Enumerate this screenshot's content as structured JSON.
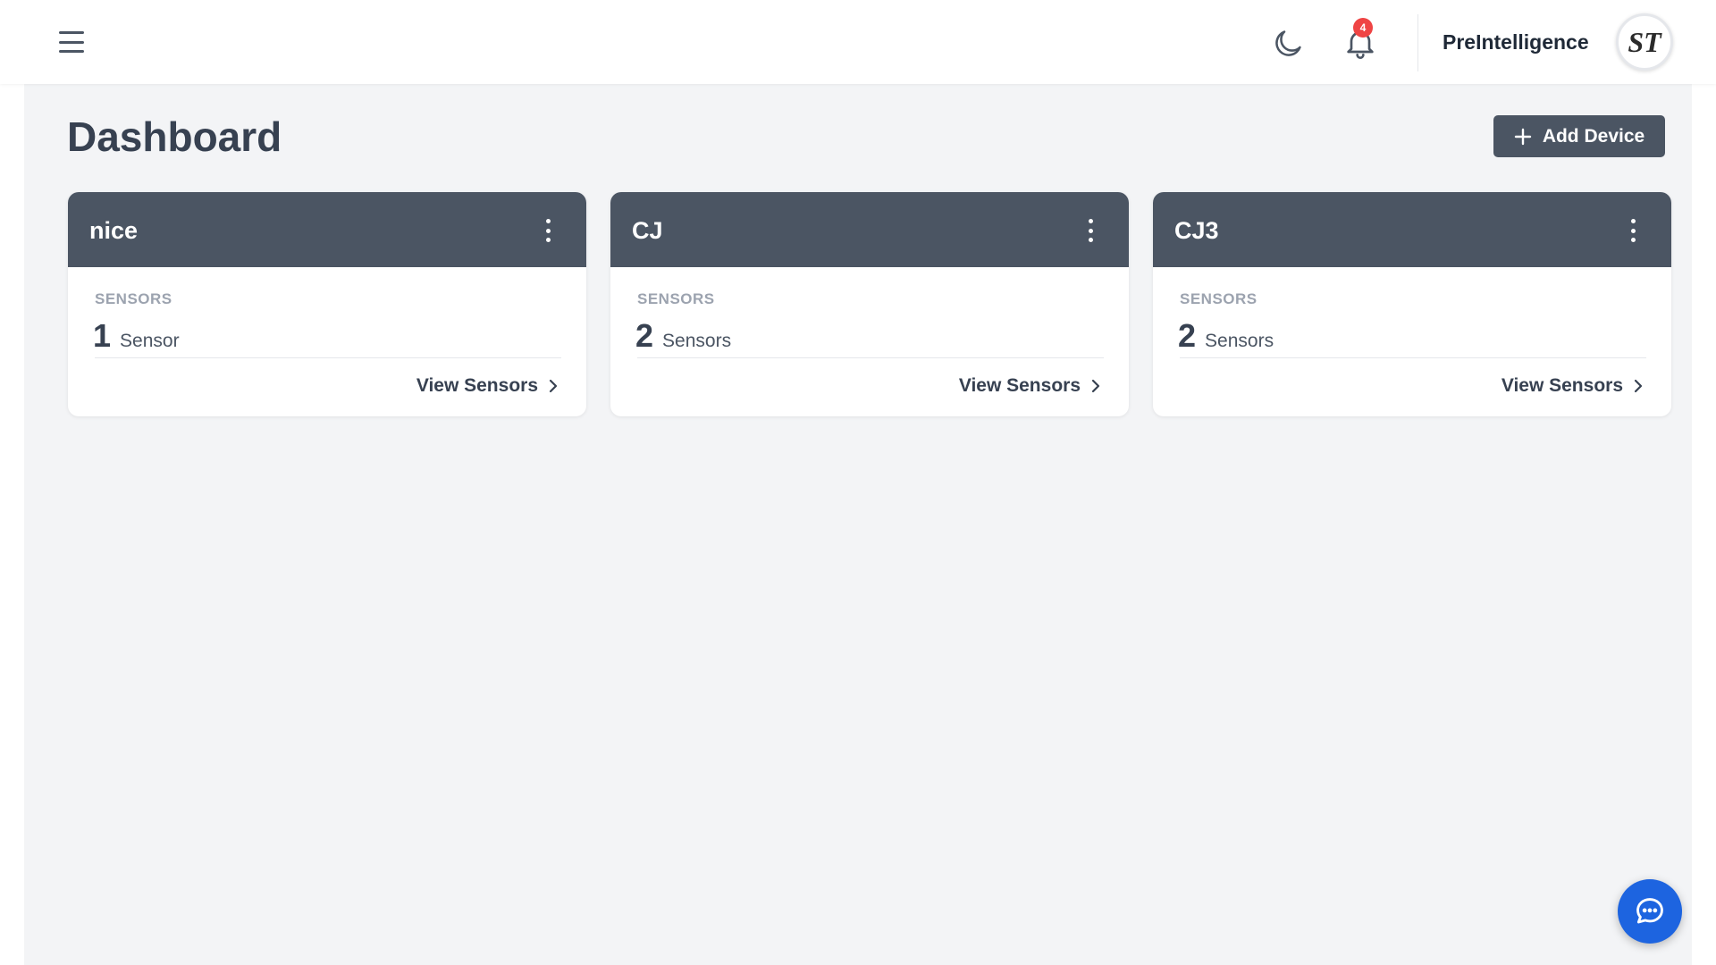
{
  "header": {
    "username": "PreIntelligence",
    "notification_count": "4",
    "avatar_initials": "ST",
    "icons": {
      "menu": "hamburger-menu-icon",
      "theme": "moon-icon",
      "notifications": "bell-icon"
    }
  },
  "page": {
    "title": "Dashboard",
    "add_button_label": "Add Device"
  },
  "devices": [
    {
      "name": "nice",
      "sensors_label": "SENSORS",
      "sensor_count": "1",
      "sensor_unit": "Sensor",
      "view_label": "View Sensors"
    },
    {
      "name": "CJ",
      "sensors_label": "SENSORS",
      "sensor_count": "2",
      "sensor_unit": "Sensors",
      "view_label": "View Sensors"
    },
    {
      "name": "CJ3",
      "sensors_label": "SENSORS",
      "sensor_count": "2",
      "sensor_unit": "Sensors",
      "view_label": "View Sensors"
    }
  ],
  "colors": {
    "card_header": "#4b5563",
    "page_bg": "#f3f4f6",
    "badge": "#ef4444",
    "chat_button": "#1d64e0"
  }
}
